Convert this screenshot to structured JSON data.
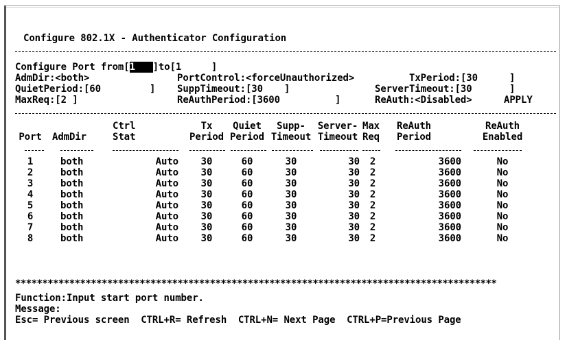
{
  "title": "Configure 802.1X - Authenticator Configuration",
  "config": {
    "port_from_label": "Configure Port from[",
    "port_from_value": "1",
    "port_to_label": "]to[",
    "port_to_value": "1",
    "port_close": "]",
    "admdir": "AdmDir:<both>",
    "portcontrol": "PortControl:<forceUnauthorized>",
    "txperiod": "TxPeriod:[30",
    "txperiod_close": "]",
    "quietperiod": "QuietPeriod:[60",
    "quietperiod_close": "]",
    "supptimeout": "SuppTimeout:[30",
    "supptimeout_close": "]",
    "servertimeout": "ServerTimeout:[30",
    "servertimeout_close": "]",
    "maxreq": "MaxReq:[2 ]",
    "reauthperiod": "ReAuthPeriod:[3600",
    "reauthperiod_close": "]",
    "reauth": "ReAuth:<Disabled>",
    "apply": "APPLY"
  },
  "table": {
    "headers_top": [
      "",
      "",
      "Ctrl",
      "Tx",
      "Quiet",
      "Supp-",
      "Server-",
      "Max",
      "ReAuth",
      "ReAuth"
    ],
    "headers_bottom": [
      "Port",
      "AdmDir",
      "Stat",
      "Period",
      "Period",
      "Timeout",
      "Timeout",
      "Req",
      "Period",
      "Enabled"
    ],
    "rows": [
      [
        "1",
        "both",
        "Auto",
        "30",
        "60",
        "30",
        "30",
        "2",
        "3600",
        "No"
      ],
      [
        "2",
        "both",
        "Auto",
        "30",
        "60",
        "30",
        "30",
        "2",
        "3600",
        "No"
      ],
      [
        "3",
        "both",
        "Auto",
        "30",
        "60",
        "30",
        "30",
        "2",
        "3600",
        "No"
      ],
      [
        "4",
        "both",
        "Auto",
        "30",
        "60",
        "30",
        "30",
        "2",
        "3600",
        "No"
      ],
      [
        "5",
        "both",
        "Auto",
        "30",
        "60",
        "30",
        "30",
        "2",
        "3600",
        "No"
      ],
      [
        "6",
        "both",
        "Auto",
        "30",
        "60",
        "30",
        "30",
        "2",
        "3600",
        "No"
      ],
      [
        "7",
        "both",
        "Auto",
        "30",
        "60",
        "30",
        "30",
        "2",
        "3600",
        "No"
      ],
      [
        "8",
        "both",
        "Auto",
        "30",
        "60",
        "30",
        "30",
        "2",
        "3600",
        "No"
      ]
    ]
  },
  "stars": "*****************************************************************************************",
  "footer": {
    "function": "Function:Input start port number.",
    "message": "Message:",
    "keys": "Esc= Previous screen  CTRL+R= Refresh  CTRL+N= Next Page  CTRL+P=Previous Page"
  }
}
